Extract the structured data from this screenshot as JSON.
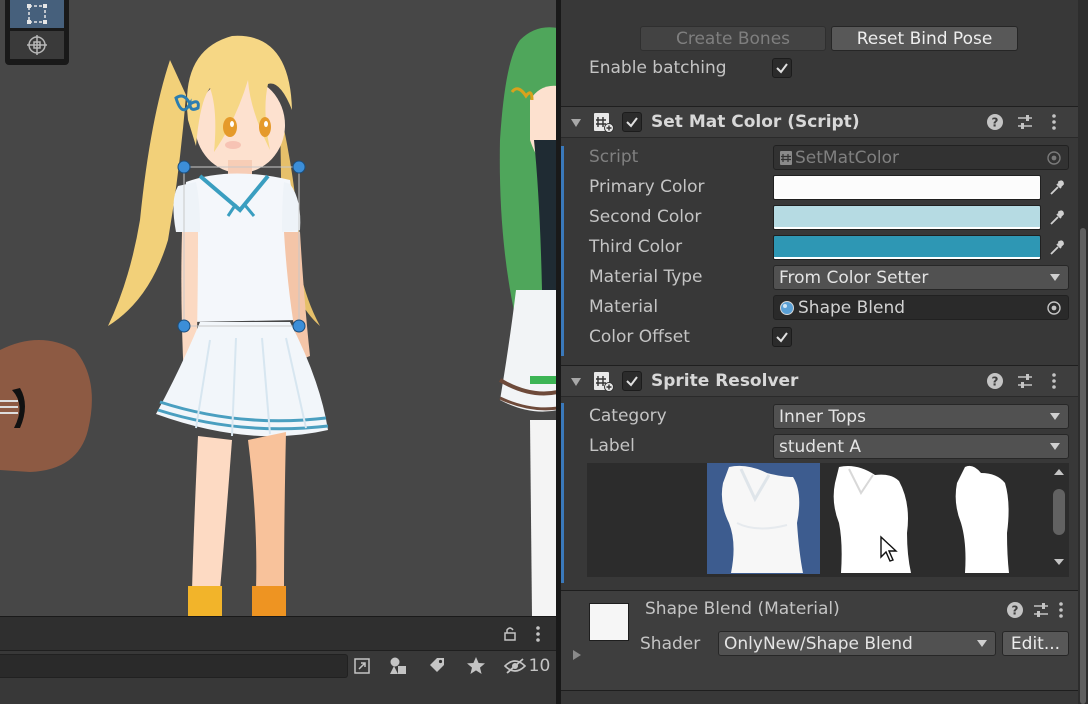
{
  "scene": {
    "tools": [
      "rect-tool-icon",
      "transform-tool-icon"
    ]
  },
  "bottom_bar": {
    "hidden_count": "10"
  },
  "inspector": {
    "buttons": {
      "create_bones": "Create Bones",
      "reset_bind_pose": "Reset Bind Pose"
    },
    "enable_batching": {
      "label": "Enable batching",
      "checked": true
    },
    "set_mat_color": {
      "title": "Set Mat Color (Script)",
      "enabled": true,
      "fields": {
        "script_label": "Script",
        "script_value": "SetMatColor",
        "primary_label": "Primary Color",
        "primary_color": "#fcfcfc",
        "second_label": "Second Color",
        "second_color": "#b6dbe3",
        "third_label": "Third Color",
        "third_color": "#2e97b4",
        "material_type_label": "Material Type",
        "material_type_value": "From Color Setter",
        "material_label": "Material",
        "material_value": "Shape Blend",
        "color_offset_label": "Color Offset",
        "color_offset_checked": true
      }
    },
    "sprite_resolver": {
      "title": "Sprite Resolver",
      "enabled": true,
      "category_label": "Category",
      "category_value": "Inner Tops",
      "label_label": "Label",
      "label_value": "student A",
      "selected_index": 0
    },
    "material": {
      "title": "Shape Blend (Material)",
      "shader_label": "Shader",
      "shader_value": "OnlyNew/Shape Blend",
      "edit_label": "Edit..."
    }
  },
  "colors": {
    "accent": "#3a79bb",
    "selected_cell": "#3d5c8f"
  }
}
